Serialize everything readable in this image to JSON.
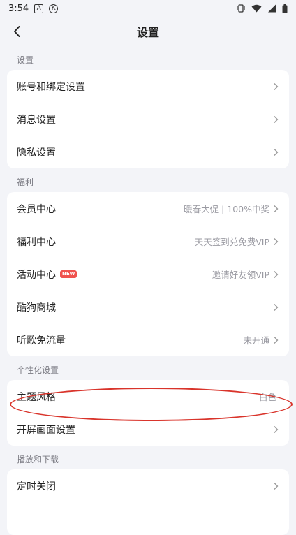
{
  "status_bar": {
    "time": "3:54",
    "icons": [
      "a-notification-icon",
      "k-notification-icon",
      "vibrate-icon",
      "wifi-icon",
      "signal-icon",
      "battery-icon"
    ]
  },
  "header": {
    "title": "设置",
    "back_icon": "chevron-left-icon"
  },
  "sections": [
    {
      "label": "设置",
      "items": [
        {
          "label": "账号和绑定设置",
          "value": ""
        },
        {
          "label": "消息设置",
          "value": ""
        },
        {
          "label": "隐私设置",
          "value": ""
        }
      ]
    },
    {
      "label": "福利",
      "items": [
        {
          "label": "会员中心",
          "value": "暖春大促 | 100%中奖"
        },
        {
          "label": "福利中心",
          "value": "天天签到兑免费VIP"
        },
        {
          "label": "活动中心",
          "badge": "NEW",
          "value": "邀请好友领VIP"
        },
        {
          "label": "酷狗商城",
          "value": ""
        },
        {
          "label": "听歌免流量",
          "value": "未开通"
        }
      ]
    },
    {
      "label": "个性化设置",
      "items": [
        {
          "label": "主题风格",
          "value": "白色"
        },
        {
          "label": "开屏画面设置",
          "value": ""
        }
      ]
    },
    {
      "label": "播放和下载",
      "items": [
        {
          "label": "定时关闭",
          "value": ""
        }
      ]
    }
  ],
  "colors": {
    "background": "#f3f4f8",
    "card": "#ffffff",
    "annotation": "#d9342b",
    "badge": "#f0524e"
  }
}
